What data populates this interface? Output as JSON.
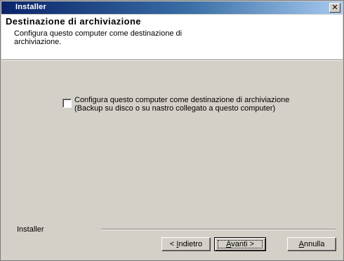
{
  "window": {
    "title": "Installer",
    "close_glyph": "✕"
  },
  "header": {
    "title": "Destinazione di archiviazione",
    "description": "Configura questo computer come destinazione di archiviazione."
  },
  "option": {
    "checked": false,
    "label_line1": "Configura questo computer come destinazione di archiviazione",
    "label_line2": "(Backup su disco o su nastro collegato a questo computer)"
  },
  "footer": {
    "label": "Installer"
  },
  "buttons": {
    "back_prefix": "< ",
    "back_mnemonic": "I",
    "back_rest": "ndietro",
    "next_mnemonic": "A",
    "next_rest": "vanti >",
    "cancel_mnemonic": "A",
    "cancel_rest": "nnulla"
  }
}
